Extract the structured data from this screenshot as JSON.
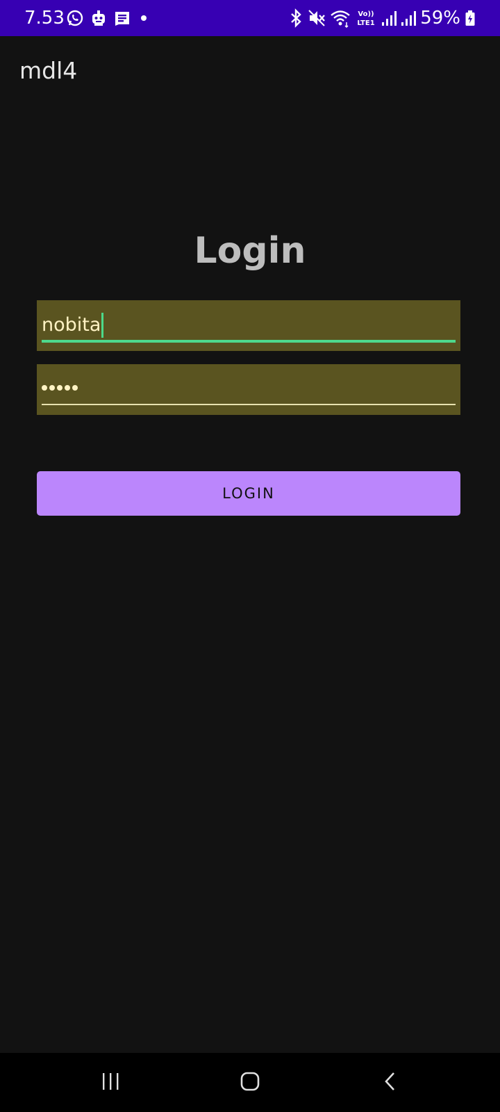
{
  "status_bar": {
    "time": "7.53",
    "battery_text": "59%",
    "left_icons": [
      "whatsapp-icon",
      "robot-icon",
      "message-icon",
      "dot-icon"
    ],
    "right_icons": [
      "bluetooth-icon",
      "mute-icon",
      "wifi-icon",
      "volte-icon",
      "signal-icon",
      "signal-icon",
      "battery-icon"
    ],
    "volte_text": "Vo))",
    "lte_text": "LTE1",
    "color": "#3700b3"
  },
  "app_bar": {
    "title": "mdl4"
  },
  "login_form": {
    "heading": "Login",
    "username_value": "nobita",
    "password_mask_count": 5,
    "button_label": "LOGIN",
    "field_color": "#5a5420",
    "focus_color": "#4ed98c",
    "button_color": "#bb86fc"
  },
  "nav_bar": {
    "buttons": [
      "recents-icon",
      "home-icon",
      "back-icon"
    ]
  }
}
